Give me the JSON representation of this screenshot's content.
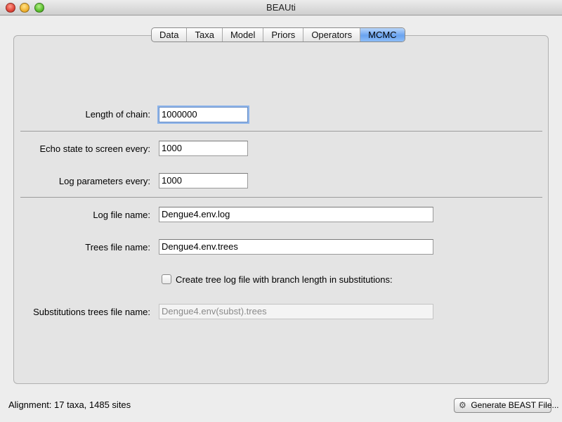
{
  "window": {
    "title": "BEAUti"
  },
  "tabs": [
    {
      "label": "Data"
    },
    {
      "label": "Taxa"
    },
    {
      "label": "Model"
    },
    {
      "label": "Priors"
    },
    {
      "label": "Operators"
    },
    {
      "label": "MCMC",
      "active": true
    }
  ],
  "mcmc": {
    "chain_length": {
      "label": "Length of chain:",
      "value": "1000000"
    },
    "echo_state": {
      "label": "Echo state to screen every:",
      "value": "1000"
    },
    "log_params": {
      "label": "Log parameters every:",
      "value": "1000"
    },
    "log_file": {
      "label": "Log file name:",
      "value": "Dengue4.env.log"
    },
    "trees_file": {
      "label": "Trees file name:",
      "value": "Dengue4.env.trees"
    },
    "subst_checkbox": {
      "label": "Create tree log file with branch length in substitutions:",
      "checked": false
    },
    "subst_trees_file": {
      "label": "Substitutions trees file name:",
      "value": "Dengue4.env(subst).trees"
    }
  },
  "status": {
    "alignment": "Alignment: 17 taxa, 1485 sites"
  },
  "footer": {
    "generate_label": "Generate BEAST File...",
    "generate_icon": "gear-icon"
  },
  "colors": {
    "active_tab": "#6aa3f0",
    "focus_ring": "#8db4ea"
  }
}
